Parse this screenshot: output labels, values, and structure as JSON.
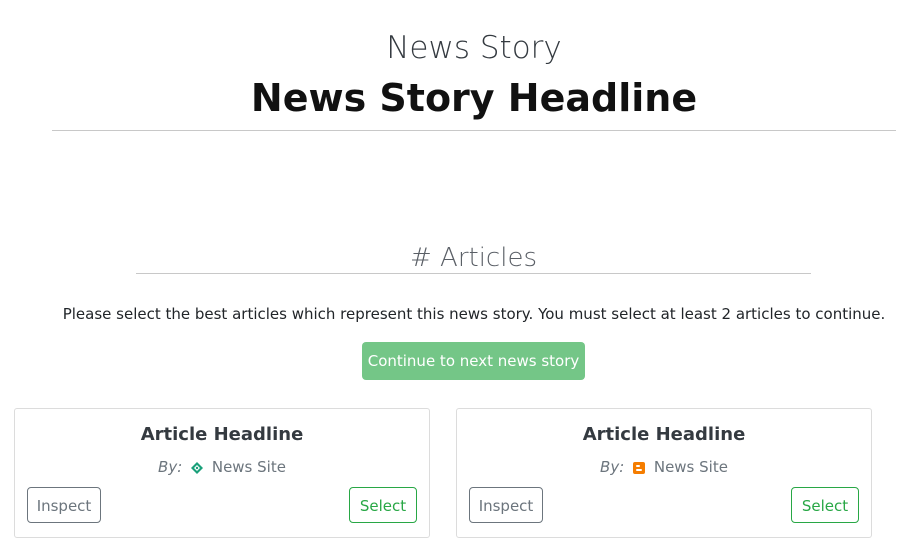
{
  "header": {
    "label": "News Story",
    "headline": "News Story Headline"
  },
  "articles_section": {
    "heading": "# Articles",
    "instructions": "Please select the best articles which represent this news story. You must select at least 2 articles to continue.",
    "continue_label": "Continue to next news story"
  },
  "articles": [
    {
      "title": "Article Headline",
      "by_label": "By:",
      "source": "News Site",
      "icon": "green-diamond-favicon-icon",
      "inspect_label": "Inspect",
      "select_label": "Select"
    },
    {
      "title": "Article Headline",
      "by_label": "By:",
      "source": "News Site",
      "icon": "orange-blogger-favicon-icon",
      "inspect_label": "Inspect",
      "select_label": "Select"
    }
  ],
  "colors": {
    "continue_button": "#74c687",
    "select_outline": "#28a745",
    "inspect_outline": "#6c757d"
  }
}
